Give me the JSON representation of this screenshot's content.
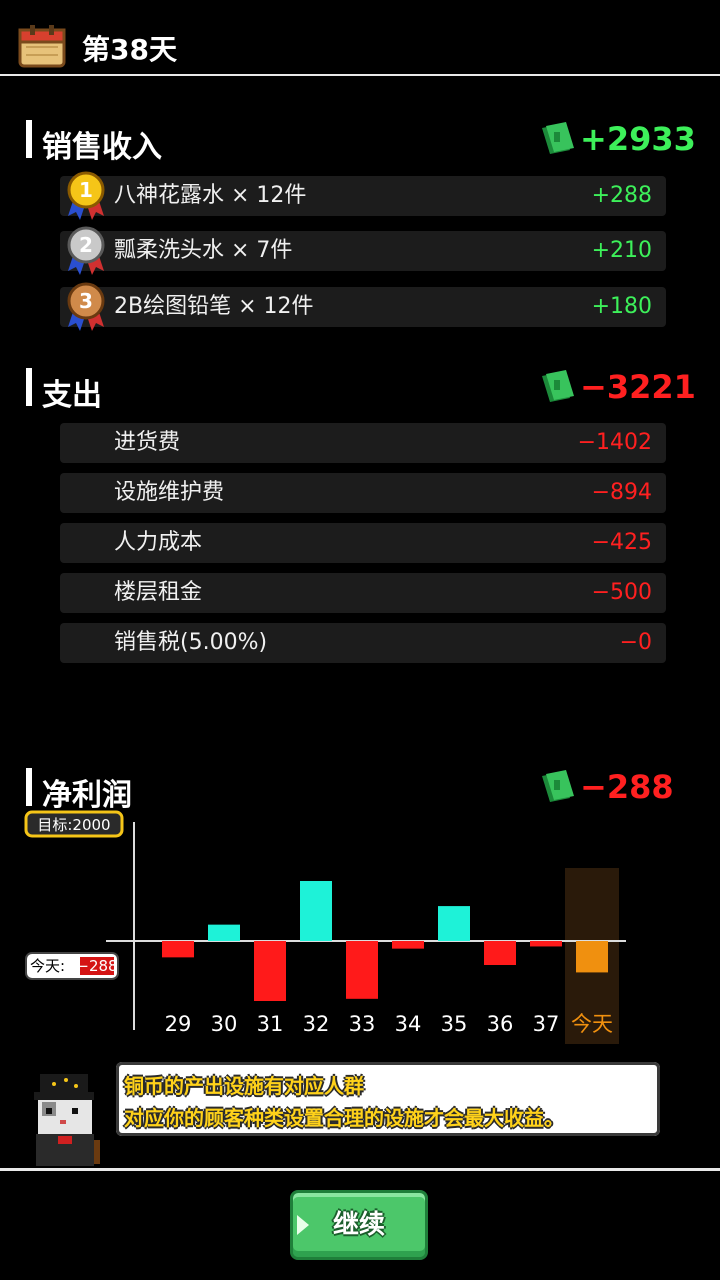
{
  "header": {
    "day": "第38天",
    "icon": "calendar-icon"
  },
  "sales": {
    "title": "销售收入",
    "total": "+2933",
    "items": [
      {
        "rank": "1",
        "label": "八神花露水 × 12件",
        "value": "+288",
        "medal": "gold-medal-icon"
      },
      {
        "rank": "2",
        "label": "瓢柔洗头水 × 7件",
        "value": "+210",
        "medal": "silver-medal-icon"
      },
      {
        "rank": "3",
        "label": "2B绘图铅笔 × 12件",
        "value": "+180",
        "medal": "bronze-medal-icon"
      }
    ]
  },
  "expenses": {
    "title": "支出",
    "total": "−3221",
    "items": [
      {
        "label": "进货费",
        "value": "−1402"
      },
      {
        "label": "设施维护费",
        "value": "−894"
      },
      {
        "label": "人力成本",
        "value": "−425"
      },
      {
        "label": "楼层租金",
        "value": "−500"
      },
      {
        "label": "销售税(5.00%)",
        "value": "−0"
      }
    ]
  },
  "profit": {
    "title": "净利润",
    "total": "−288",
    "target_label": "目标:2000",
    "today_label": "今天:",
    "today_value": "−288"
  },
  "chart_data": {
    "type": "bar",
    "categories": [
      "29",
      "30",
      "31",
      "32",
      "33",
      "34",
      "35",
      "36",
      "37",
      "今天"
    ],
    "values": [
      -150,
      150,
      -550,
      550,
      -530,
      -70,
      320,
      -220,
      -50,
      -288
    ],
    "target": 2000,
    "highlight_category": "今天",
    "colors": {
      "positive": "#1ef2d8",
      "negative": "#ff1a1a",
      "today": "#f0900f",
      "today_bg": "#2a1a0a"
    }
  },
  "tip": {
    "line1": "铜币的产出设施有对应人群",
    "line2": "对应你的顾客种类设置合理的设施才会最大收益。"
  },
  "footer": {
    "continue_label": "继续"
  },
  "colors": {
    "positive": "#3df05a",
    "negative": "#ff2020",
    "background": "#000000"
  }
}
